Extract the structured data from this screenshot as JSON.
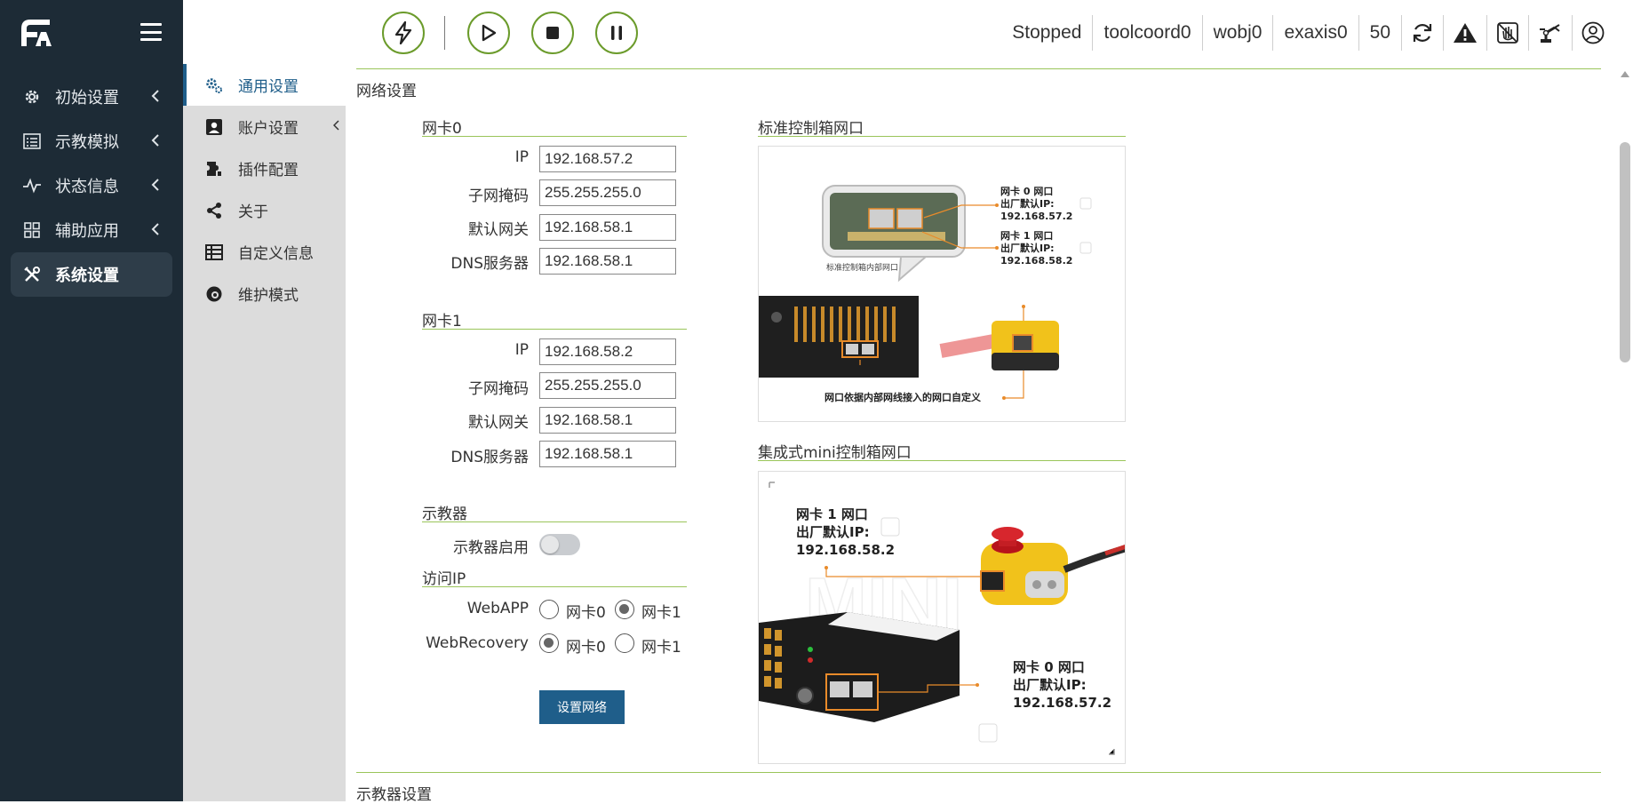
{
  "sidebar": {
    "items": [
      {
        "label": "初始设置",
        "icon": "gear-icon"
      },
      {
        "label": "示教模拟",
        "icon": "list-icon"
      },
      {
        "label": "状态信息",
        "icon": "pulse-icon"
      },
      {
        "label": "辅助应用",
        "icon": "grid-icon"
      },
      {
        "label": "系统设置",
        "icon": "tools-icon"
      }
    ]
  },
  "submenu": {
    "items": [
      {
        "label": "通用设置",
        "icon": "cog-icon"
      },
      {
        "label": "账户设置",
        "icon": "account-icon"
      },
      {
        "label": "插件配置",
        "icon": "plugin-icon"
      },
      {
        "label": "关于",
        "icon": "share-icon"
      },
      {
        "label": "自定义信息",
        "icon": "table-icon"
      },
      {
        "label": "维护模式",
        "icon": "maintenance-icon"
      }
    ]
  },
  "topbar": {
    "status": "Stopped",
    "tool": "toolcoord0",
    "wobj": "wobj0",
    "exaxis": "exaxis0",
    "speed": "50"
  },
  "network": {
    "title": "网络设置",
    "nic0": {
      "title": "网卡0",
      "ip_label": "IP",
      "ip": "192.168.57.2",
      "mask_label": "子网掩码",
      "mask": "255.255.255.0",
      "gw_label": "默认网关",
      "gw": "192.168.58.1",
      "dns_label": "DNS服务器",
      "dns": "192.168.58.1"
    },
    "nic1": {
      "title": "网卡1",
      "ip_label": "IP",
      "ip": "192.168.58.2",
      "mask_label": "子网掩码",
      "mask": "255.255.255.0",
      "gw_label": "默认网关",
      "gw": "192.168.58.1",
      "dns_label": "DNS服务器",
      "dns": "192.168.58.1"
    },
    "pendant": {
      "title": "示教器",
      "enable_label": "示教器启用",
      "enabled": false
    },
    "access": {
      "title": "访问IP",
      "webapp_label": "WebAPP",
      "webrecovery_label": "WebRecovery",
      "opt0": "网卡0",
      "opt1": "网卡1",
      "webapp_selected": "网卡1",
      "webrecovery_selected": "网卡0"
    },
    "submit": "设置网络"
  },
  "figures": {
    "standard": {
      "title": "标准控制箱网口",
      "caption_inner": "标准控制箱内部网口",
      "nic0_l1": "网卡 0 网口",
      "nic0_l2": "出厂默认IP:",
      "nic0_l3": "192.168.57.2",
      "nic1_l1": "网卡 1 网口",
      "nic1_l2": "出厂默认IP:",
      "nic1_l3": "192.168.58.2",
      "bottom": "网口依据内部网线接入的网口自定义"
    },
    "mini": {
      "title": "集成式mini控制箱网口",
      "nic1_l1": "网卡 1 网口",
      "nic1_l2": "出厂默认IP:",
      "nic1_l3": "192.168.58.2",
      "nic0_l1": "网卡 0 网口",
      "nic0_l2": "出厂默认IP:",
      "nic0_l3": "192.168.57.2",
      "watermark": "MINI"
    }
  },
  "next_section": "示教器设置",
  "colors": {
    "sidebar_bg": "#1d2b36",
    "accent_green": "#9ac55a",
    "control_green": "#6b9b2b",
    "primary_blue": "#1f5e8a",
    "callout_orange": "#e98b2a"
  }
}
